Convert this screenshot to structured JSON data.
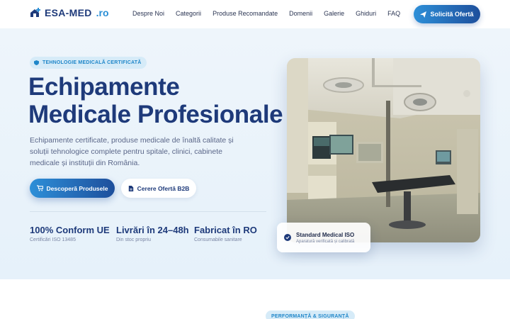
{
  "brand": {
    "name": "ESA-MED",
    "tld": ".ro",
    "icon": "house-plus-icon",
    "color": "#1e3a7a",
    "accent": "#2a8fd6"
  },
  "nav": {
    "items": [
      "Despre Noi",
      "Categorii",
      "Produse Recomandate",
      "Domenii",
      "Galerie",
      "Ghiduri",
      "FAQ"
    ]
  },
  "header_cta": {
    "label": "Solicită Ofertă",
    "icon": "send-icon"
  },
  "hero": {
    "badge": "TEHNOLOGIE MEDICALĂ CERTIFICATĂ",
    "badge_icon": "shield-icon",
    "title_line1": "Echipamente",
    "title_line2": "Medicale Profesionale",
    "description": "Echipamente certificate, produse medicale de înaltă calitate și soluții tehnologice complete pentru spitale, clinici, cabinete medicale și instituții din România.",
    "primary_button": {
      "label": "Descoperă Produsele",
      "icon": "cart-icon"
    },
    "secondary_button": {
      "label": "Cerere Ofertă B2B",
      "icon": "document-icon"
    },
    "stats": [
      {
        "value": "100% Conform UE",
        "label": "Certificări ISO 13485"
      },
      {
        "value": "Livrări în 24–48h",
        "label": "Din stoc propriu"
      },
      {
        "value": "Fabricat în RO",
        "label": "Consumabile sanitare"
      }
    ],
    "image_alt": "operating-room-photo",
    "float_card": {
      "title": "Standard Medical ISO",
      "subtitle": "Aparatură verificată și calibrată",
      "icon": "check-circle-icon"
    }
  },
  "next_section": {
    "badge": "PERFORMANȚĂ & SIGURANȚĂ"
  },
  "colors": {
    "primary": "#1e3a7a",
    "accent": "#2d8fd8",
    "hero_bg": "#eef5fb",
    "badge_bg": "#d6ebf8"
  }
}
